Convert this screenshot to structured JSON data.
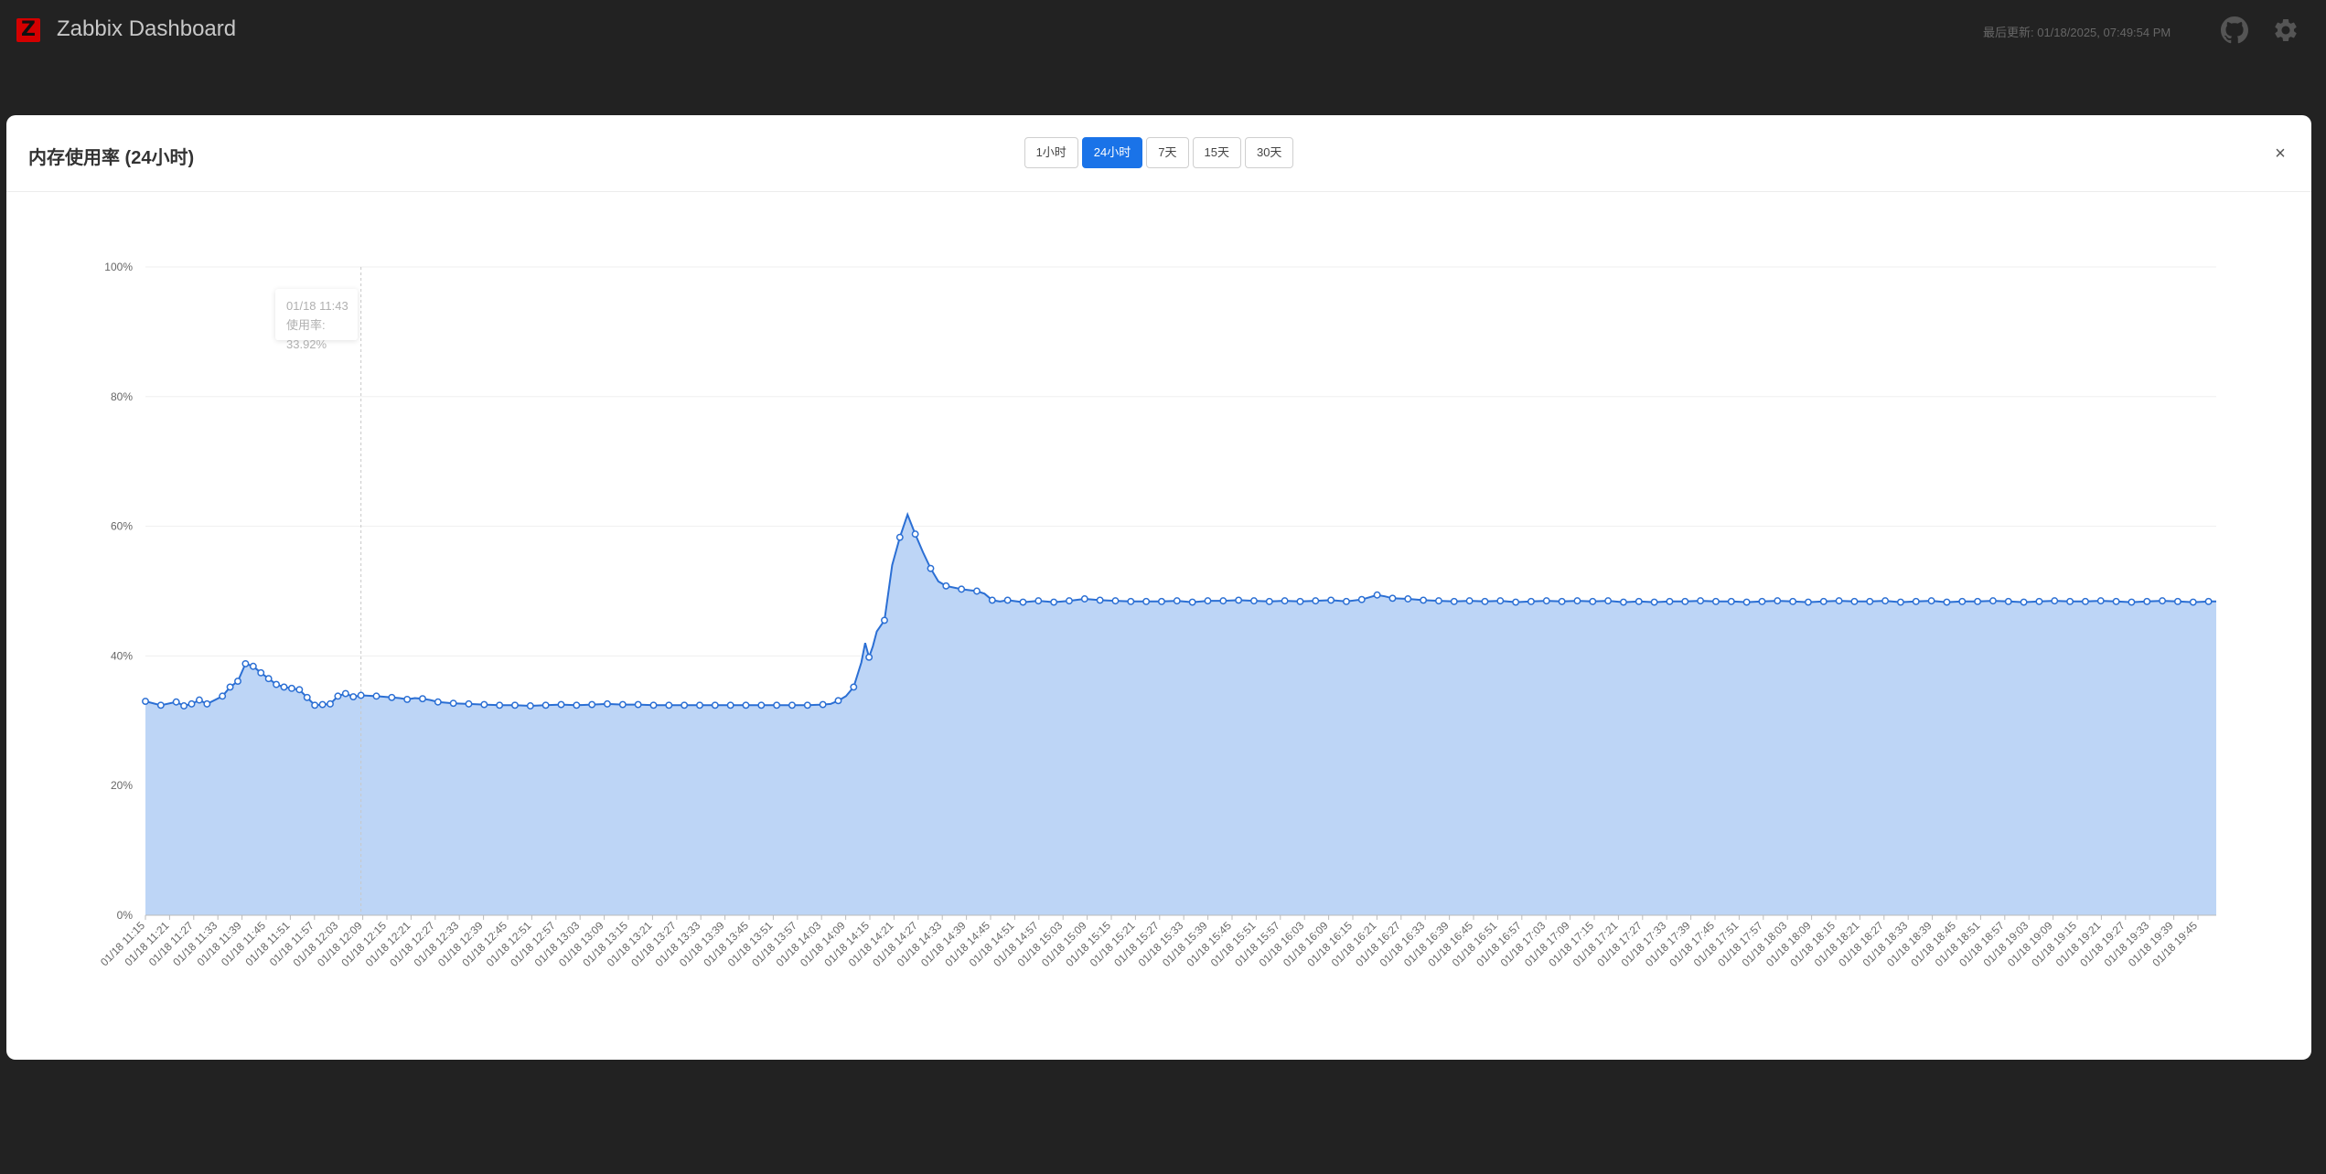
{
  "app": {
    "title": "Zabbix Dashboard",
    "last_update": "最后更新: 01/18/2025, 07:49:54 PM"
  },
  "icons": {
    "logo": "zabbix-logo",
    "github": "github-icon",
    "settings": "gear-icon",
    "close": "close-icon"
  },
  "modal": {
    "title": "内存使用率 (24小时)",
    "close_label": "×"
  },
  "ranges": [
    {
      "label": "1小时",
      "active": false
    },
    {
      "label": "24小时",
      "active": true
    },
    {
      "label": "7天",
      "active": false
    },
    {
      "label": "15天",
      "active": false
    },
    {
      "label": "30天",
      "active": false
    }
  ],
  "tooltip": {
    "time": "01/18 11:43",
    "value": "使用率: 33.92%"
  },
  "colors": {
    "accent": "#1a73e8",
    "line": "#2b6fd4",
    "area": "#bdd5f6",
    "background": "#222222"
  },
  "chart_data": {
    "type": "area",
    "title": "",
    "xlabel": "",
    "ylabel": "",
    "ylim": [
      0,
      100
    ],
    "yticks": [
      "0%",
      "20%",
      "40%",
      "60%",
      "80%",
      "100%"
    ],
    "grid": true,
    "legend": "none",
    "x_tick_labels": [
      "01/18 11:15",
      "01/18 11:21",
      "01/18 11:27",
      "01/18 11:33",
      "01/18 11:39",
      "01/18 11:45",
      "01/18 11:51",
      "01/18 11:57",
      "01/18 12:03",
      "01/18 12:09",
      "01/18 12:15",
      "01/18 12:21",
      "01/18 12:27",
      "01/18 12:33",
      "01/18 12:39",
      "01/18 12:45",
      "01/18 12:51",
      "01/18 12:57",
      "01/18 13:03",
      "01/18 13:09",
      "01/18 13:15",
      "01/18 13:21",
      "01/18 13:27",
      "01/18 13:33",
      "01/18 13:39",
      "01/18 13:45",
      "01/18 13:51",
      "01/18 13:57",
      "01/18 14:03",
      "01/18 14:09",
      "01/18 14:15",
      "01/18 14:21",
      "01/18 14:27",
      "01/18 14:33",
      "01/18 14:39",
      "01/18 14:45",
      "01/18 14:51",
      "01/18 14:57",
      "01/18 15:03",
      "01/18 15:09",
      "01/18 15:15",
      "01/18 15:21",
      "01/18 15:27",
      "01/18 15:33",
      "01/18 15:39",
      "01/18 15:45",
      "01/18 15:51",
      "01/18 15:57",
      "01/18 16:03",
      "01/18 16:09",
      "01/18 16:15",
      "01/18 16:21",
      "01/18 16:27",
      "01/18 16:33",
      "01/18 16:39",
      "01/18 16:45",
      "01/18 16:51",
      "01/18 16:57",
      "01/18 17:03",
      "01/18 17:09",
      "01/18 17:15",
      "01/18 17:21",
      "01/18 17:27",
      "01/18 17:33",
      "01/18 17:39",
      "01/18 17:45",
      "01/18 17:51",
      "01/18 17:57",
      "01/18 18:03",
      "01/18 18:09",
      "01/18 18:15",
      "01/18 18:21",
      "01/18 18:27",
      "01/18 18:33",
      "01/18 18:39",
      "01/18 18:45",
      "01/18 18:51",
      "01/18 18:57",
      "01/18 19:03",
      "01/18 19:09",
      "01/18 19:15",
      "01/18 19:21",
      "01/18 19:27",
      "01/18 19:33",
      "01/18 19:39",
      "01/18 19:45"
    ],
    "x_range_minutes": [
      0,
      269
    ],
    "points": [
      [
        0,
        33.0
      ],
      [
        2,
        32.4
      ],
      [
        4,
        32.9
      ],
      [
        5,
        32.3
      ],
      [
        6,
        32.6
      ],
      [
        7,
        33.2
      ],
      [
        8,
        32.6
      ],
      [
        10,
        33.8
      ],
      [
        11,
        35.2
      ],
      [
        12,
        36.1
      ],
      [
        13,
        38.8
      ],
      [
        14,
        38.4
      ],
      [
        15,
        37.4
      ],
      [
        16,
        36.5
      ],
      [
        17,
        35.6
      ],
      [
        18,
        35.2
      ],
      [
        19,
        35.0
      ],
      [
        20,
        34.8
      ],
      [
        21,
        33.6
      ],
      [
        22,
        32.4
      ],
      [
        23,
        32.5
      ],
      [
        24,
        32.6
      ],
      [
        25,
        33.8
      ],
      [
        26,
        34.2
      ],
      [
        27,
        33.7
      ],
      [
        28,
        33.92
      ],
      [
        30,
        33.8
      ],
      [
        32,
        33.6
      ],
      [
        33,
        33.5
      ],
      [
        34,
        33.3
      ],
      [
        35,
        33.5
      ],
      [
        36,
        33.4
      ],
      [
        37,
        33.2
      ],
      [
        38,
        32.9
      ],
      [
        40,
        32.7
      ],
      [
        42,
        32.6
      ],
      [
        44,
        32.5
      ],
      [
        46,
        32.4
      ],
      [
        48,
        32.4
      ],
      [
        50,
        32.3
      ],
      [
        52,
        32.4
      ],
      [
        54,
        32.5
      ],
      [
        56,
        32.4
      ],
      [
        58,
        32.5
      ],
      [
        60,
        32.6
      ],
      [
        62,
        32.5
      ],
      [
        64,
        32.5
      ],
      [
        66,
        32.4
      ],
      [
        68,
        32.4
      ],
      [
        70,
        32.4
      ],
      [
        72,
        32.4
      ],
      [
        74,
        32.4
      ],
      [
        76,
        32.4
      ],
      [
        78,
        32.4
      ],
      [
        80,
        32.4
      ],
      [
        82,
        32.4
      ],
      [
        84,
        32.4
      ],
      [
        86,
        32.4
      ],
      [
        88,
        32.5
      ],
      [
        89,
        32.6
      ],
      [
        90,
        33.1
      ],
      [
        91,
        33.8
      ],
      [
        92,
        35.2
      ],
      [
        93,
        39.0
      ],
      [
        93.5,
        42.0
      ],
      [
        94,
        39.8
      ],
      [
        94.5,
        41.5
      ],
      [
        95,
        43.8
      ],
      [
        96,
        45.5
      ],
      [
        97,
        54.0
      ],
      [
        98,
        58.3
      ],
      [
        99,
        61.8
      ],
      [
        100,
        58.8
      ],
      [
        101,
        56.0
      ],
      [
        102,
        53.5
      ],
      [
        103,
        51.5
      ],
      [
        104,
        50.8
      ],
      [
        106,
        50.3
      ],
      [
        108,
        50.0
      ],
      [
        109,
        49.6
      ],
      [
        110,
        48.6
      ],
      [
        111,
        48.4
      ],
      [
        112,
        48.6
      ],
      [
        114,
        48.3
      ],
      [
        116,
        48.5
      ],
      [
        118,
        48.3
      ],
      [
        120,
        48.5
      ],
      [
        122,
        48.8
      ],
      [
        124,
        48.6
      ],
      [
        126,
        48.5
      ],
      [
        128,
        48.4
      ],
      [
        130,
        48.4
      ],
      [
        132,
        48.4
      ],
      [
        134,
        48.5
      ],
      [
        136,
        48.3
      ],
      [
        138,
        48.5
      ],
      [
        140,
        48.5
      ],
      [
        142,
        48.6
      ],
      [
        144,
        48.5
      ],
      [
        146,
        48.4
      ],
      [
        148,
        48.5
      ],
      [
        150,
        48.4
      ],
      [
        152,
        48.5
      ],
      [
        154,
        48.6
      ],
      [
        156,
        48.4
      ],
      [
        158,
        48.7
      ],
      [
        160,
        49.4
      ],
      [
        161,
        49.2
      ],
      [
        162,
        48.9
      ],
      [
        164,
        48.8
      ],
      [
        166,
        48.6
      ],
      [
        168,
        48.5
      ],
      [
        170,
        48.4
      ],
      [
        172,
        48.5
      ],
      [
        174,
        48.4
      ],
      [
        176,
        48.5
      ],
      [
        178,
        48.3
      ],
      [
        180,
        48.4
      ],
      [
        182,
        48.5
      ],
      [
        184,
        48.4
      ],
      [
        186,
        48.5
      ],
      [
        188,
        48.4
      ],
      [
        190,
        48.5
      ],
      [
        192,
        48.3
      ],
      [
        194,
        48.4
      ],
      [
        196,
        48.3
      ],
      [
        198,
        48.4
      ],
      [
        200,
        48.4
      ],
      [
        202,
        48.5
      ],
      [
        204,
        48.4
      ],
      [
        206,
        48.4
      ],
      [
        208,
        48.3
      ],
      [
        210,
        48.4
      ],
      [
        212,
        48.5
      ],
      [
        214,
        48.4
      ],
      [
        216,
        48.3
      ],
      [
        218,
        48.4
      ],
      [
        220,
        48.5
      ],
      [
        222,
        48.4
      ],
      [
        224,
        48.4
      ],
      [
        226,
        48.5
      ],
      [
        228,
        48.3
      ],
      [
        230,
        48.4
      ],
      [
        232,
        48.5
      ],
      [
        234,
        48.3
      ],
      [
        236,
        48.4
      ],
      [
        238,
        48.4
      ],
      [
        240,
        48.5
      ],
      [
        242,
        48.4
      ],
      [
        244,
        48.3
      ],
      [
        246,
        48.4
      ],
      [
        248,
        48.5
      ],
      [
        250,
        48.4
      ],
      [
        252,
        48.4
      ],
      [
        254,
        48.5
      ],
      [
        256,
        48.4
      ],
      [
        258,
        48.3
      ],
      [
        260,
        48.4
      ],
      [
        262,
        48.5
      ],
      [
        264,
        48.4
      ],
      [
        266,
        48.3
      ],
      [
        268,
        48.4
      ],
      [
        269,
        48.4
      ]
    ]
  }
}
